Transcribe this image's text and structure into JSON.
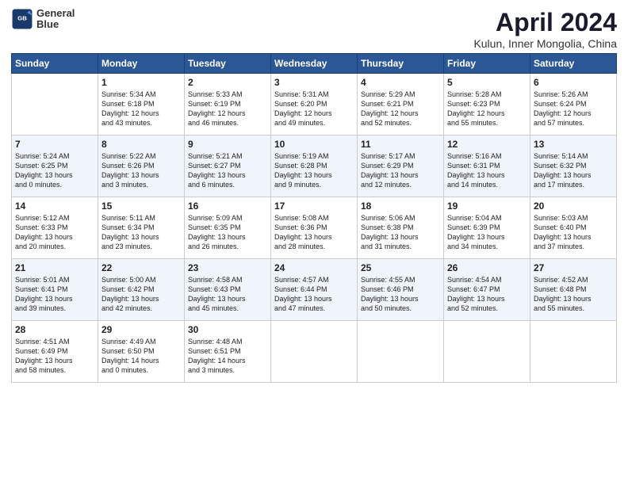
{
  "header": {
    "logo_line1": "General",
    "logo_line2": "Blue",
    "month": "April 2024",
    "location": "Kulun, Inner Mongolia, China"
  },
  "weekdays": [
    "Sunday",
    "Monday",
    "Tuesday",
    "Wednesday",
    "Thursday",
    "Friday",
    "Saturday"
  ],
  "weeks": [
    [
      {
        "day": "",
        "text": ""
      },
      {
        "day": "1",
        "text": "Sunrise: 5:34 AM\nSunset: 6:18 PM\nDaylight: 12 hours\nand 43 minutes."
      },
      {
        "day": "2",
        "text": "Sunrise: 5:33 AM\nSunset: 6:19 PM\nDaylight: 12 hours\nand 46 minutes."
      },
      {
        "day": "3",
        "text": "Sunrise: 5:31 AM\nSunset: 6:20 PM\nDaylight: 12 hours\nand 49 minutes."
      },
      {
        "day": "4",
        "text": "Sunrise: 5:29 AM\nSunset: 6:21 PM\nDaylight: 12 hours\nand 52 minutes."
      },
      {
        "day": "5",
        "text": "Sunrise: 5:28 AM\nSunset: 6:23 PM\nDaylight: 12 hours\nand 55 minutes."
      },
      {
        "day": "6",
        "text": "Sunrise: 5:26 AM\nSunset: 6:24 PM\nDaylight: 12 hours\nand 57 minutes."
      }
    ],
    [
      {
        "day": "7",
        "text": "Sunrise: 5:24 AM\nSunset: 6:25 PM\nDaylight: 13 hours\nand 0 minutes."
      },
      {
        "day": "8",
        "text": "Sunrise: 5:22 AM\nSunset: 6:26 PM\nDaylight: 13 hours\nand 3 minutes."
      },
      {
        "day": "9",
        "text": "Sunrise: 5:21 AM\nSunset: 6:27 PM\nDaylight: 13 hours\nand 6 minutes."
      },
      {
        "day": "10",
        "text": "Sunrise: 5:19 AM\nSunset: 6:28 PM\nDaylight: 13 hours\nand 9 minutes."
      },
      {
        "day": "11",
        "text": "Sunrise: 5:17 AM\nSunset: 6:29 PM\nDaylight: 13 hours\nand 12 minutes."
      },
      {
        "day": "12",
        "text": "Sunrise: 5:16 AM\nSunset: 6:31 PM\nDaylight: 13 hours\nand 14 minutes."
      },
      {
        "day": "13",
        "text": "Sunrise: 5:14 AM\nSunset: 6:32 PM\nDaylight: 13 hours\nand 17 minutes."
      }
    ],
    [
      {
        "day": "14",
        "text": "Sunrise: 5:12 AM\nSunset: 6:33 PM\nDaylight: 13 hours\nand 20 minutes."
      },
      {
        "day": "15",
        "text": "Sunrise: 5:11 AM\nSunset: 6:34 PM\nDaylight: 13 hours\nand 23 minutes."
      },
      {
        "day": "16",
        "text": "Sunrise: 5:09 AM\nSunset: 6:35 PM\nDaylight: 13 hours\nand 26 minutes."
      },
      {
        "day": "17",
        "text": "Sunrise: 5:08 AM\nSunset: 6:36 PM\nDaylight: 13 hours\nand 28 minutes."
      },
      {
        "day": "18",
        "text": "Sunrise: 5:06 AM\nSunset: 6:38 PM\nDaylight: 13 hours\nand 31 minutes."
      },
      {
        "day": "19",
        "text": "Sunrise: 5:04 AM\nSunset: 6:39 PM\nDaylight: 13 hours\nand 34 minutes."
      },
      {
        "day": "20",
        "text": "Sunrise: 5:03 AM\nSunset: 6:40 PM\nDaylight: 13 hours\nand 37 minutes."
      }
    ],
    [
      {
        "day": "21",
        "text": "Sunrise: 5:01 AM\nSunset: 6:41 PM\nDaylight: 13 hours\nand 39 minutes."
      },
      {
        "day": "22",
        "text": "Sunrise: 5:00 AM\nSunset: 6:42 PM\nDaylight: 13 hours\nand 42 minutes."
      },
      {
        "day": "23",
        "text": "Sunrise: 4:58 AM\nSunset: 6:43 PM\nDaylight: 13 hours\nand 45 minutes."
      },
      {
        "day": "24",
        "text": "Sunrise: 4:57 AM\nSunset: 6:44 PM\nDaylight: 13 hours\nand 47 minutes."
      },
      {
        "day": "25",
        "text": "Sunrise: 4:55 AM\nSunset: 6:46 PM\nDaylight: 13 hours\nand 50 minutes."
      },
      {
        "day": "26",
        "text": "Sunrise: 4:54 AM\nSunset: 6:47 PM\nDaylight: 13 hours\nand 52 minutes."
      },
      {
        "day": "27",
        "text": "Sunrise: 4:52 AM\nSunset: 6:48 PM\nDaylight: 13 hours\nand 55 minutes."
      }
    ],
    [
      {
        "day": "28",
        "text": "Sunrise: 4:51 AM\nSunset: 6:49 PM\nDaylight: 13 hours\nand 58 minutes."
      },
      {
        "day": "29",
        "text": "Sunrise: 4:49 AM\nSunset: 6:50 PM\nDaylight: 14 hours\nand 0 minutes."
      },
      {
        "day": "30",
        "text": "Sunrise: 4:48 AM\nSunset: 6:51 PM\nDaylight: 14 hours\nand 3 minutes."
      },
      {
        "day": "",
        "text": ""
      },
      {
        "day": "",
        "text": ""
      },
      {
        "day": "",
        "text": ""
      },
      {
        "day": "",
        "text": ""
      }
    ]
  ]
}
